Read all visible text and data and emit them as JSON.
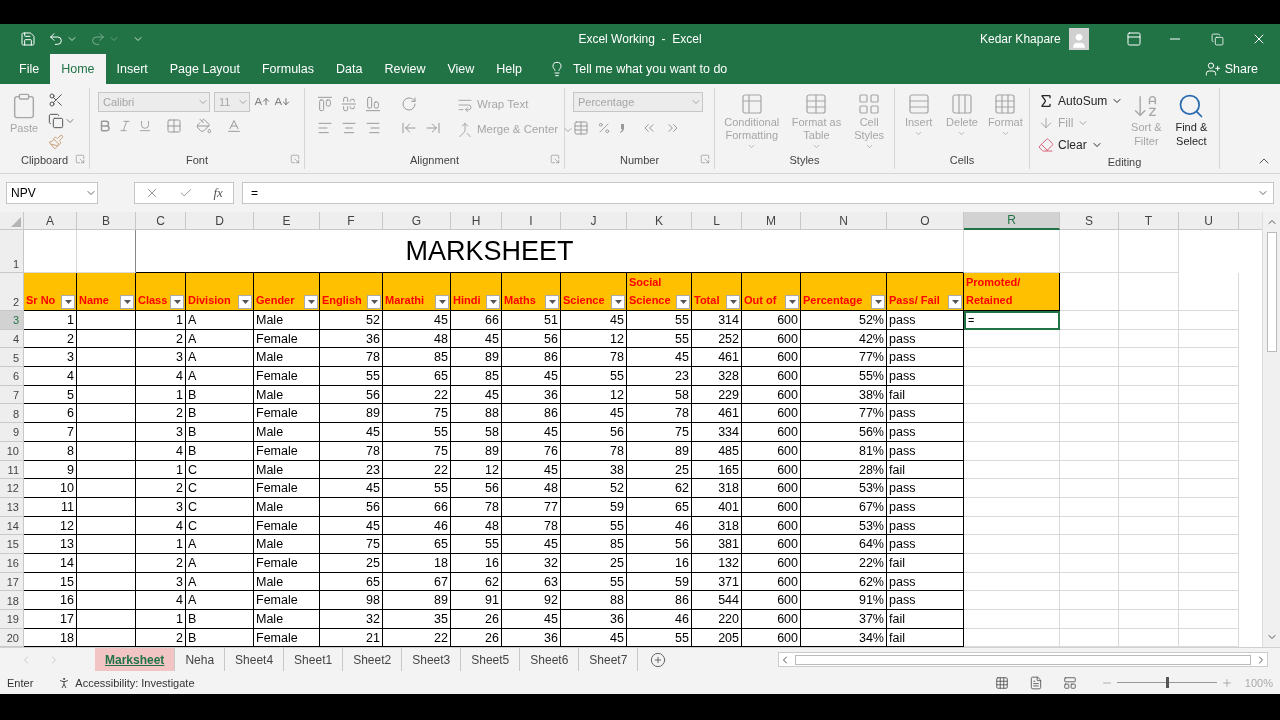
{
  "title_bar": {
    "title": "Excel Working  -  Excel",
    "user": "Kedar Khapare"
  },
  "menu_tabs": [
    {
      "label": "File",
      "selected": false
    },
    {
      "label": "Home",
      "selected": true
    },
    {
      "label": "Insert",
      "selected": false
    },
    {
      "label": "Page Layout",
      "selected": false
    },
    {
      "label": "Formulas",
      "selected": false
    },
    {
      "label": "Data",
      "selected": false
    },
    {
      "label": "Review",
      "selected": false
    },
    {
      "label": "View",
      "selected": false
    },
    {
      "label": "Help",
      "selected": false
    }
  ],
  "tell_me": {
    "placeholder": "Tell me what you want to do"
  },
  "share": "Share",
  "ribbon": {
    "clipboard": {
      "label": "Clipboard",
      "paste": {
        "label": "Paste",
        "disabled": true
      }
    },
    "font": {
      "label": "Font",
      "font_name": "Calibri",
      "font_size": "11",
      "disabled": true
    },
    "alignment": {
      "label": "Alignment",
      "wrap_text": {
        "label": "Wrap Text",
        "disabled": true
      },
      "merge_center": {
        "label": "Merge & Center",
        "disabled": true
      }
    },
    "number": {
      "label": "Number",
      "format": "Percentage",
      "disabled": true
    },
    "styles": {
      "label": "Styles",
      "buttons": [
        {
          "label": "Conditional Formatting",
          "disabled": true
        },
        {
          "label": "Format as Table",
          "disabled": true
        },
        {
          "label": "Cell Styles",
          "disabled": true
        }
      ]
    },
    "cells": {
      "label": "Cells",
      "buttons": [
        {
          "label": "Insert",
          "disabled": true
        },
        {
          "label": "Delete",
          "disabled": true
        },
        {
          "label": "Format",
          "disabled": true
        }
      ]
    },
    "editing": {
      "label": "Editing",
      "autosum": {
        "label": "AutoSum",
        "disabled": false
      },
      "fill": {
        "label": "Fill",
        "disabled": true
      },
      "clear": {
        "label": "Clear",
        "disabled": false
      },
      "sort_filter": {
        "label": "Sort & Filter",
        "disabled": true
      },
      "find_select": {
        "label": "Find & Select",
        "disabled": false
      }
    }
  },
  "formula_bar": {
    "name_box": "NPV",
    "function_label": "fx",
    "value": "="
  },
  "column_headers": [
    {
      "letter": "A",
      "selected": false
    },
    {
      "letter": "B",
      "selected": false
    },
    {
      "letter": "C",
      "selected": false
    },
    {
      "letter": "D",
      "selected": false
    },
    {
      "letter": "E",
      "selected": false
    },
    {
      "letter": "F",
      "selected": false
    },
    {
      "letter": "G",
      "selected": false
    },
    {
      "letter": "H",
      "selected": false
    },
    {
      "letter": "I",
      "selected": false
    },
    {
      "letter": "J",
      "selected": false
    },
    {
      "letter": "K",
      "selected": false
    },
    {
      "letter": "L",
      "selected": false
    },
    {
      "letter": "M",
      "selected": false
    },
    {
      "letter": "N",
      "selected": false
    },
    {
      "letter": "O",
      "selected": false
    },
    {
      "letter": "R",
      "selected": true
    },
    {
      "letter": "S",
      "selected": false
    },
    {
      "letter": "T",
      "selected": false
    },
    {
      "letter": "U",
      "selected": false
    }
  ],
  "title_row": {
    "number": "1",
    "selected": false,
    "title": "MARKSHEET"
  },
  "table": {
    "header_row": {
      "number": "2",
      "selected": false
    },
    "columns": [
      {
        "header": "Sr No",
        "kind": "number"
      },
      {
        "header": "Name",
        "kind": "blank"
      },
      {
        "header": "Class",
        "kind": "number"
      },
      {
        "header": "Division",
        "kind": "text"
      },
      {
        "header": "Gender",
        "kind": "text"
      },
      {
        "header": "English",
        "kind": "number"
      },
      {
        "header": "Marathi",
        "kind": "number"
      },
      {
        "header": "Hindi",
        "kind": "number"
      },
      {
        "header": "Maths",
        "kind": "number"
      },
      {
        "header": "Science",
        "kind": "number"
      },
      {
        "header": "Social Science",
        "kind": "number"
      },
      {
        "header": "Total",
        "kind": "number"
      },
      {
        "header": "Out of",
        "kind": "number"
      },
      {
        "header": "Percentage",
        "kind": "number"
      },
      {
        "header": "Pass/ Fail",
        "kind": "text"
      }
    ],
    "rows": [
      {
        "number": "3",
        "selected": true,
        "values": [
          "1",
          "1",
          "A",
          "Male",
          "52",
          "45",
          "66",
          "51",
          "45",
          "55",
          "314",
          "600",
          "52%",
          "pass"
        ]
      },
      {
        "number": "4",
        "selected": false,
        "values": [
          "2",
          "2",
          "A",
          "Female",
          "36",
          "48",
          "45",
          "56",
          "12",
          "55",
          "252",
          "600",
          "42%",
          "pass"
        ]
      },
      {
        "number": "5",
        "selected": false,
        "values": [
          "3",
          "3",
          "A",
          "Male",
          "78",
          "85",
          "89",
          "86",
          "78",
          "45",
          "461",
          "600",
          "77%",
          "pass"
        ]
      },
      {
        "number": "6",
        "selected": false,
        "values": [
          "4",
          "4",
          "A",
          "Female",
          "55",
          "65",
          "85",
          "45",
          "55",
          "23",
          "328",
          "600",
          "55%",
          "pass"
        ]
      },
      {
        "number": "7",
        "selected": false,
        "values": [
          "5",
          "1",
          "B",
          "Male",
          "56",
          "22",
          "45",
          "36",
          "12",
          "58",
          "229",
          "600",
          "38%",
          "fail"
        ]
      },
      {
        "number": "8",
        "selected": false,
        "values": [
          "6",
          "2",
          "B",
          "Female",
          "89",
          "75",
          "88",
          "86",
          "45",
          "78",
          "461",
          "600",
          "77%",
          "pass"
        ]
      },
      {
        "number": "9",
        "selected": false,
        "values": [
          "7",
          "3",
          "B",
          "Male",
          "45",
          "55",
          "58",
          "45",
          "56",
          "75",
          "334",
          "600",
          "56%",
          "pass"
        ]
      },
      {
        "number": "10",
        "selected": false,
        "values": [
          "8",
          "4",
          "B",
          "Female",
          "78",
          "75",
          "89",
          "76",
          "78",
          "89",
          "485",
          "600",
          "81%",
          "pass"
        ]
      },
      {
        "number": "11",
        "selected": false,
        "values": [
          "9",
          "1",
          "C",
          "Male",
          "23",
          "22",
          "12",
          "45",
          "38",
          "25",
          "165",
          "600",
          "28%",
          "fail"
        ]
      },
      {
        "number": "12",
        "selected": false,
        "values": [
          "10",
          "2",
          "C",
          "Female",
          "45",
          "55",
          "56",
          "48",
          "52",
          "62",
          "318",
          "600",
          "53%",
          "pass"
        ]
      },
      {
        "number": "13",
        "selected": false,
        "values": [
          "11",
          "3",
          "C",
          "Male",
          "56",
          "66",
          "78",
          "77",
          "59",
          "65",
          "401",
          "600",
          "67%",
          "pass"
        ]
      },
      {
        "number": "14",
        "selected": false,
        "values": [
          "12",
          "4",
          "C",
          "Female",
          "45",
          "46",
          "48",
          "78",
          "55",
          "46",
          "318",
          "600",
          "53%",
          "pass"
        ]
      },
      {
        "number": "15",
        "selected": false,
        "values": [
          "13",
          "1",
          "A",
          "Male",
          "75",
          "65",
          "55",
          "45",
          "85",
          "56",
          "381",
          "600",
          "64%",
          "pass"
        ]
      },
      {
        "number": "16",
        "selected": false,
        "values": [
          "14",
          "2",
          "A",
          "Female",
          "25",
          "18",
          "16",
          "32",
          "25",
          "16",
          "132",
          "600",
          "22%",
          "fail"
        ]
      },
      {
        "number": "17",
        "selected": false,
        "values": [
          "15",
          "3",
          "A",
          "Male",
          "65",
          "67",
          "62",
          "63",
          "55",
          "59",
          "371",
          "600",
          "62%",
          "pass"
        ]
      },
      {
        "number": "18",
        "selected": false,
        "values": [
          "16",
          "4",
          "A",
          "Female",
          "98",
          "89",
          "91",
          "92",
          "88",
          "86",
          "544",
          "600",
          "91%",
          "pass"
        ]
      },
      {
        "number": "19",
        "selected": false,
        "values": [
          "17",
          "1",
          "B",
          "Male",
          "32",
          "35",
          "26",
          "45",
          "36",
          "46",
          "220",
          "600",
          "37%",
          "fail"
        ]
      },
      {
        "number": "20",
        "selected": false,
        "values": [
          "18",
          "2",
          "B",
          "Female",
          "21",
          "22",
          "26",
          "36",
          "45",
          "55",
          "205",
          "600",
          "34%",
          "fail"
        ]
      }
    ]
  },
  "extra_column": {
    "header": "Promoted/ Retained",
    "active_cell": "="
  },
  "sheet_tabs": [
    {
      "label": "Marksheet",
      "selected": true
    },
    {
      "label": "Neha",
      "selected": false
    },
    {
      "label": "Sheet4",
      "selected": false
    },
    {
      "label": "Sheet1",
      "selected": false
    },
    {
      "label": "Sheet2",
      "selected": false
    },
    {
      "label": "Sheet3",
      "selected": false
    },
    {
      "label": "Sheet5",
      "selected": false
    },
    {
      "label": "Sheet6",
      "selected": false
    },
    {
      "label": "Sheet7",
      "selected": false
    }
  ],
  "status_bar": {
    "mode": "Enter",
    "accessibility": "Accessibility: Investigate",
    "zoom": {
      "level": 0.5,
      "reading": "100%"
    }
  }
}
